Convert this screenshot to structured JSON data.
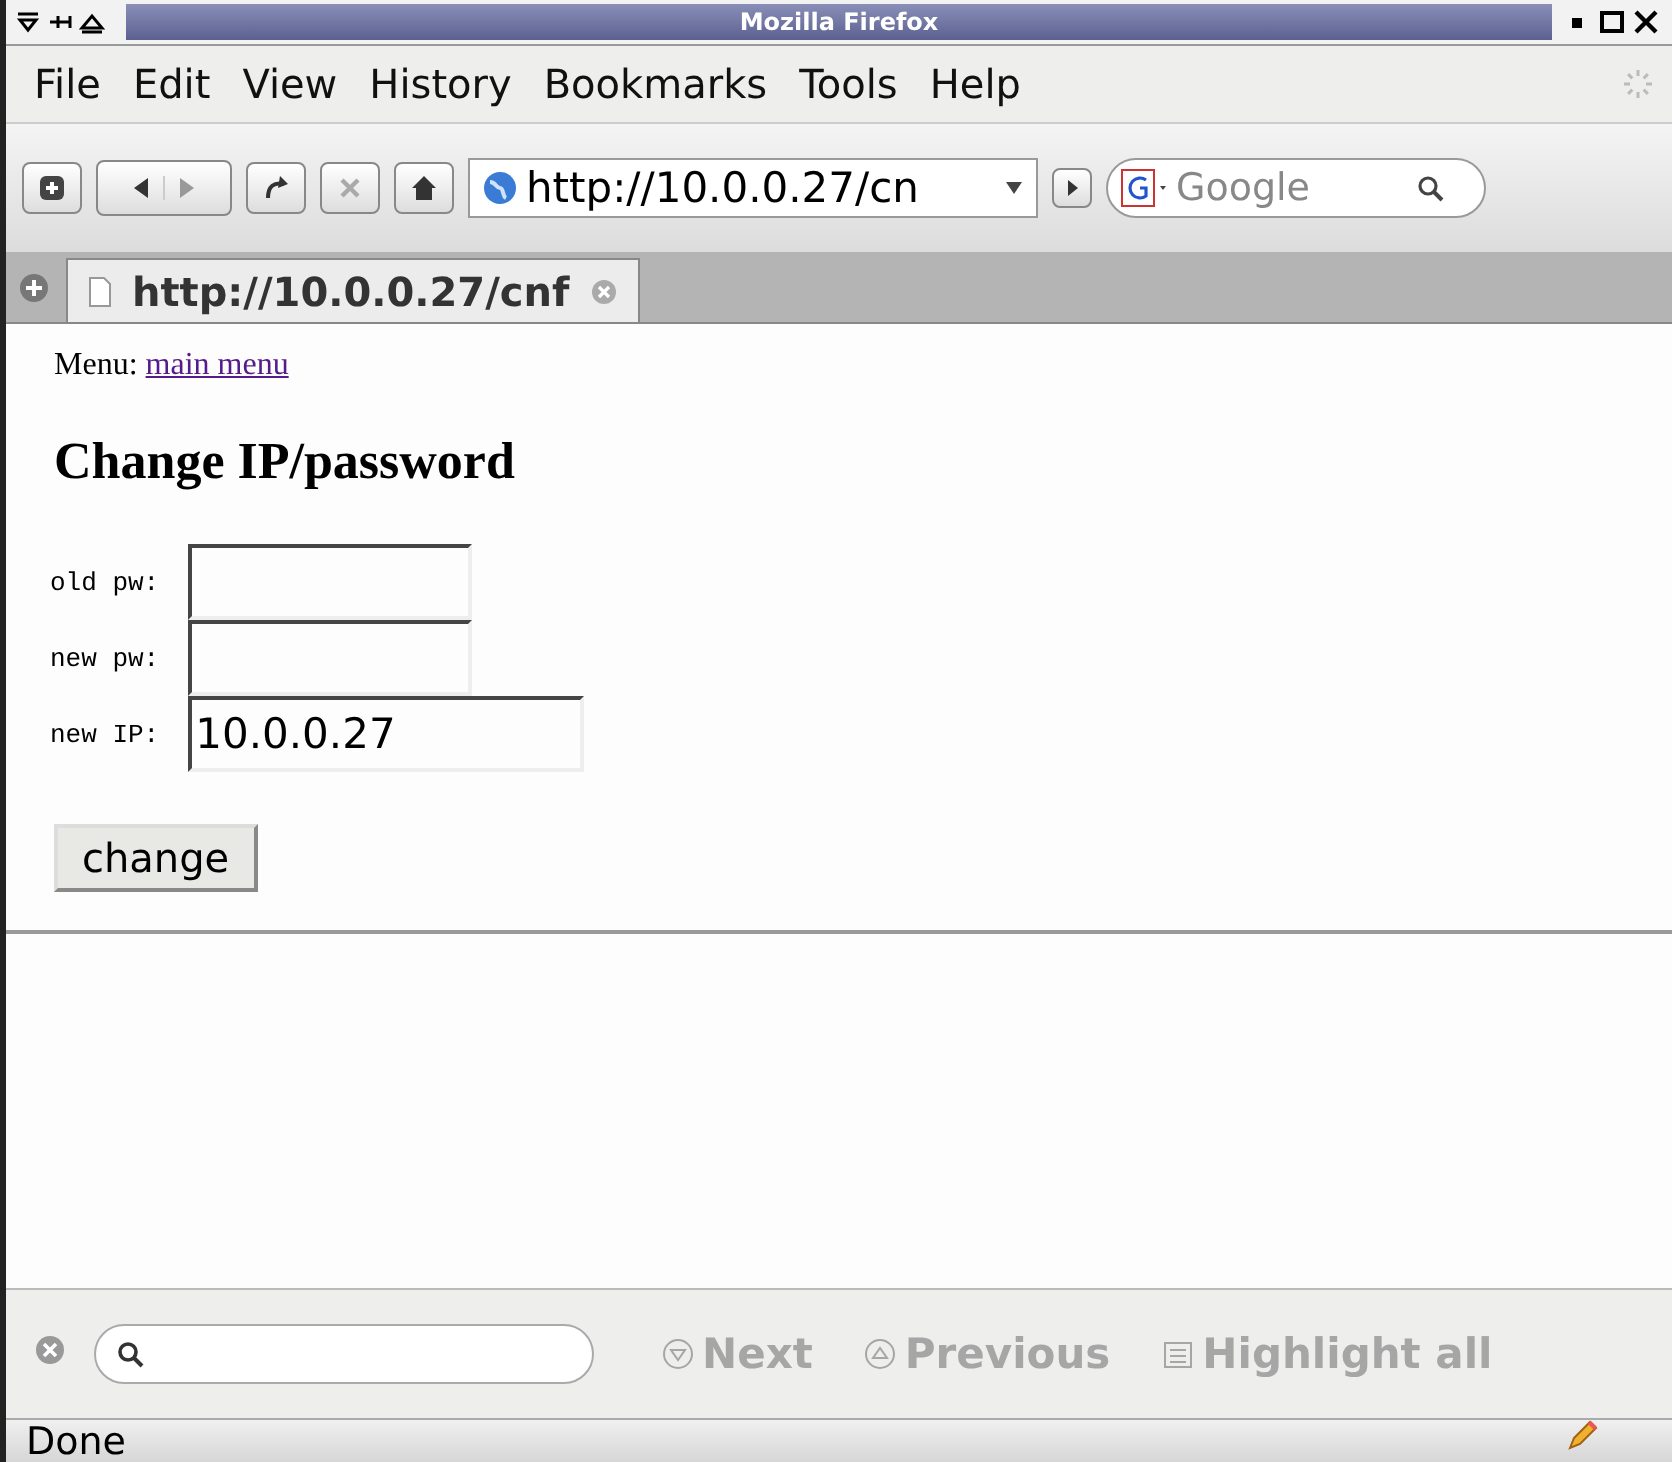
{
  "window": {
    "title": "Mozilla Firefox"
  },
  "menu": [
    {
      "label": "File"
    },
    {
      "label": "Edit"
    },
    {
      "label": "View"
    },
    {
      "label": "History"
    },
    {
      "label": "Bookmarks"
    },
    {
      "label": "Tools"
    },
    {
      "label": "Help"
    }
  ],
  "toolbar": {
    "url": "http://10.0.0.27/cn",
    "search_placeholder": "Google"
  },
  "tabs": [
    {
      "label": "http://10.0.0.27/cnf",
      "selected": true
    }
  ],
  "page": {
    "menu_label": "Menu:",
    "menu_link": "main menu",
    "heading": "Change IP/password",
    "fields": [
      {
        "label": "old pw:",
        "kind": "short"
      },
      {
        "label": "new pw:",
        "kind": "short"
      },
      {
        "label": "new IP:",
        "value": "10.0.0.27",
        "kind": "long"
      }
    ],
    "submit": "change"
  },
  "find_bar": {
    "buttons": [
      {
        "label": "Next",
        "disabled": true,
        "kind": "next"
      },
      {
        "label": "Previous",
        "disabled": true,
        "kind": "previous"
      },
      {
        "label": "Highlight all",
        "disabled": true,
        "kind": "highlight"
      }
    ]
  },
  "status_bar": {
    "text": "Done"
  }
}
